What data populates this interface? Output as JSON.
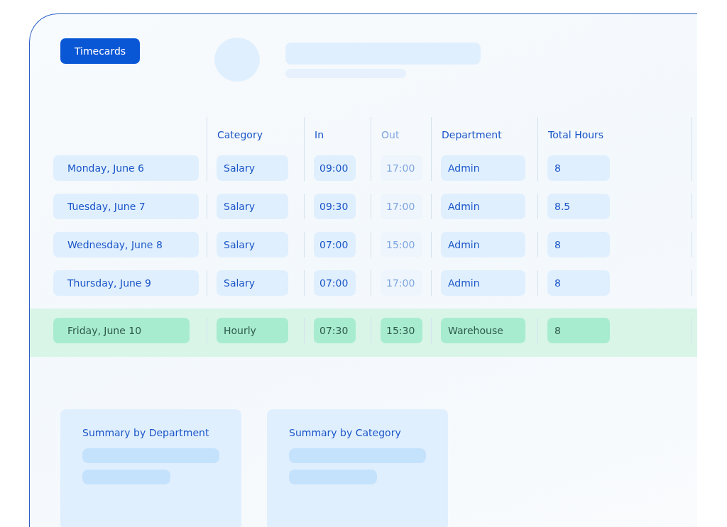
{
  "header": {
    "button": "Timecards"
  },
  "table": {
    "columns": [
      {
        "label": "Category",
        "faded": false
      },
      {
        "label": "In",
        "faded": false
      },
      {
        "label": "Out",
        "faded": true
      },
      {
        "label": "Department",
        "faded": false
      },
      {
        "label": "Total Hours",
        "faded": false
      }
    ],
    "rows": [
      {
        "date": "Monday, June 6",
        "cells": [
          "Salary",
          "09:00",
          "17:00",
          "Admin",
          "8"
        ],
        "selected": false
      },
      {
        "date": "Tuesday, June 7",
        "cells": [
          "Salary",
          "09:30",
          "17:00",
          "Admin",
          "8.5"
        ],
        "selected": false
      },
      {
        "date": "Wednesday, June 8",
        "cells": [
          "Salary",
          "07:00",
          "15:00",
          "Admin",
          "8"
        ],
        "selected": false
      },
      {
        "date": "Thursday, June 9",
        "cells": [
          "Salary",
          "07:00",
          "17:00",
          "Admin",
          "8"
        ],
        "selected": false
      },
      {
        "date": "Friday, June 10",
        "cells": [
          "Hourly",
          "07:30",
          "15:30",
          "Warehouse",
          "8"
        ],
        "selected": true
      }
    ]
  },
  "summaries": [
    {
      "title": "Summary by Department"
    },
    {
      "title": "Summary by Category"
    }
  ]
}
